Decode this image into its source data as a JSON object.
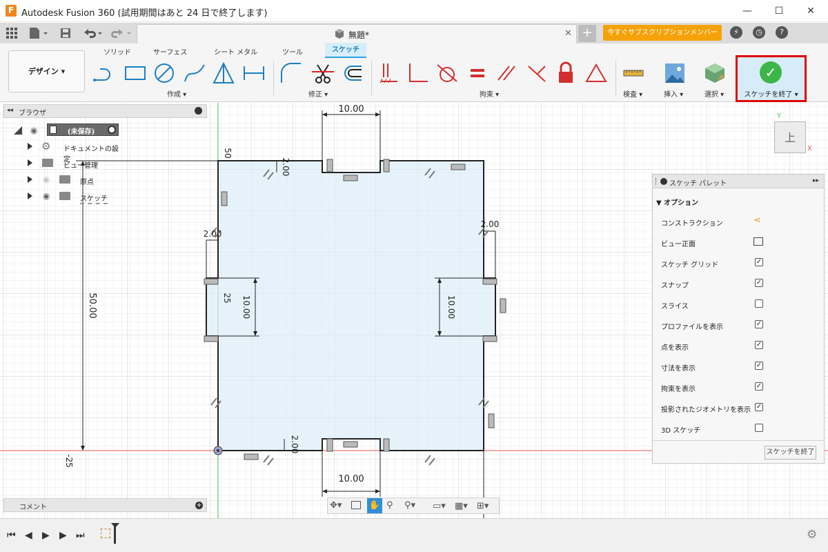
{
  "window": {
    "title": "Autodesk Fusion 360 (試用期間はあと 24 日で終了します)",
    "app_icon_letter": "F",
    "minimize": "—",
    "maximize": "☐",
    "close": "✕"
  },
  "tabbar": {
    "doc_title": "無題*",
    "doc_close": "✕",
    "new_tab": "+",
    "subscribe": "今すぐサブスクリプションメンバーに...",
    "icons": [
      "grid-menu-icon",
      "file-icon",
      "save-icon",
      "undo-icon",
      "redo-icon",
      "jobs-icon",
      "clock-icon",
      "help-icon"
    ]
  },
  "ribbon": {
    "workspace": "デザイン ▾",
    "tabs": [
      "ソリッド",
      "サーフェス",
      "シート メタル",
      "ツール",
      "スケッチ"
    ],
    "active_tab": "スケッチ",
    "groups": {
      "create": "作成 ▾",
      "modify": "修正 ▾",
      "constraints": "拘束 ▾",
      "inspect": "検査 ▾",
      "insert": "挿入 ▾",
      "select": "選択 ▾"
    },
    "finish_sketch": "スケッチを終了 ▾",
    "accent": "#29a3e5",
    "finish_highlight": "#e00000"
  },
  "browser": {
    "title": "ブラウザ",
    "root": "(未保存)",
    "items": [
      "ドキュメントの設定",
      "ビュー管理",
      "原点",
      "スケッチ"
    ]
  },
  "comments": {
    "label": "コメント"
  },
  "viewcube": {
    "face": "上",
    "axis_x": "X",
    "axis_y": "Y"
  },
  "canvas": {
    "dims": {
      "top_width": "10.00",
      "bottom_width": "10.00",
      "height": "50.00",
      "top_notch": "2.00",
      "bottom_notch": "2.00",
      "left_notch": "2.00",
      "right_notch": "2.00",
      "left_slot_height": "10.00",
      "right_slot_height": "10.00",
      "left_25": "25",
      "top_50": "50",
      "bottom_neg25": "-25"
    }
  },
  "palette": {
    "title": "スケッチ パレット",
    "section": "オプション",
    "rows": [
      {
        "label": "コンストラクション",
        "type": "icon",
        "value": "construction-icon"
      },
      {
        "label": "ビュー正面",
        "type": "icon",
        "value": "look-at-icon"
      },
      {
        "label": "スケッチ グリッド",
        "type": "check",
        "value": "✓"
      },
      {
        "label": "スナップ",
        "type": "check",
        "value": "✓"
      },
      {
        "label": "スライス",
        "type": "check",
        "value": ""
      },
      {
        "label": "プロファイルを表示",
        "type": "check",
        "value": "✓"
      },
      {
        "label": "点を表示",
        "type": "check",
        "value": "✓"
      },
      {
        "label": "寸法を表示",
        "type": "check",
        "value": "✓"
      },
      {
        "label": "拘束を表示",
        "type": "check",
        "value": "✓"
      },
      {
        "label": "投影されたジオメトリを表示",
        "type": "check",
        "value": "✓"
      },
      {
        "label": "3D スケッチ",
        "type": "check",
        "value": ""
      }
    ],
    "finish_button": "スケッチを終了"
  },
  "playback": {
    "first": "⏮",
    "prev": "◀",
    "play": "▶",
    "next": "▶",
    "last": "⏭",
    "settings": "⚙"
  }
}
